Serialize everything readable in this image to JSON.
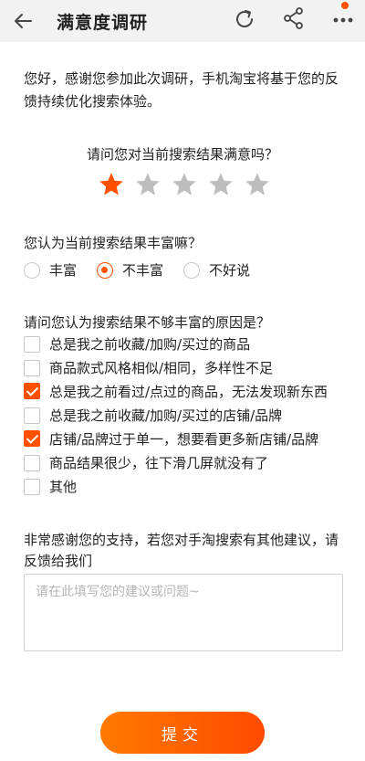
{
  "header": {
    "title": "满意度调研",
    "icons": {
      "back": "back-arrow-icon",
      "refresh": "refresh-icon",
      "share": "share-icon",
      "more": "more-icon"
    },
    "notification_dot_color": "#ff5000"
  },
  "intro": "您好，感谢您参加此次调研，手机淘宝将基于您的反馈持续优化搜索体验。",
  "rating": {
    "question": "请问您对当前搜索结果满意吗？",
    "max": 5,
    "value": 1,
    "active_color": "#ff5000",
    "inactive_color": "#bdbdbd"
  },
  "richness": {
    "question": "您认为当前搜索结果丰富嘛？",
    "options": [
      "丰富",
      "不丰富",
      "不好说"
    ],
    "selected": "不丰富"
  },
  "reasons": {
    "question": "请问您认为搜索结果不够丰富的原因是？",
    "options": [
      {
        "label": "总是我之前收藏/加购/买过的商品",
        "checked": false
      },
      {
        "label": "商品款式风格相似/相同，多样性不足",
        "checked": false
      },
      {
        "label": "总是我之前看过/点过的商品，无法发现新东西",
        "checked": true
      },
      {
        "label": "总是我之前收藏/加购/买过的店铺/品牌",
        "checked": false
      },
      {
        "label": "店铺/品牌过于单一，想要看更多新店铺/品牌",
        "checked": true
      },
      {
        "label": "商品结果很少，往下滑几屏就没有了",
        "checked": false
      },
      {
        "label": "其他",
        "checked": false
      }
    ]
  },
  "feedback": {
    "prompt": "非常感谢您的支持，若您对手淘搜索有其他建议，请反馈给我们",
    "placeholder": "请在此填写您的建议或问题~",
    "value": ""
  },
  "submit_label": "提交",
  "accent_color": "#ff5000"
}
